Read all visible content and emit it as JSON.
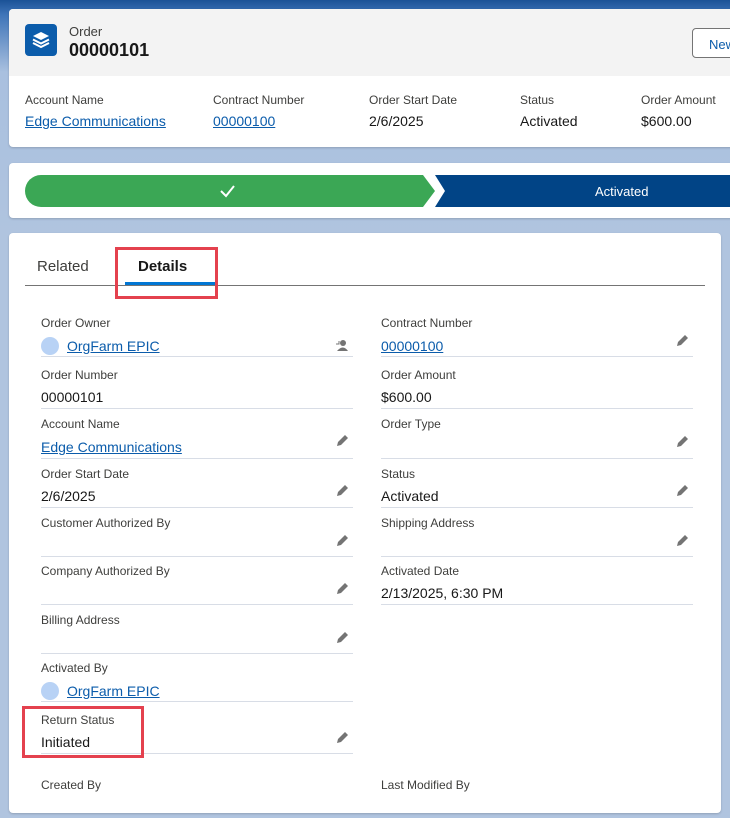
{
  "header": {
    "object_type": "Order",
    "title": "00000101",
    "new_button": "New",
    "fields": [
      {
        "label": "Account Name",
        "value": "Edge Communications"
      },
      {
        "label": "Contract Number",
        "value": "00000100"
      },
      {
        "label": "Order Start Date",
        "value": "2/6/2025"
      },
      {
        "label": "Status",
        "value": "Activated"
      },
      {
        "label": "Order Amount",
        "value": "$600.00"
      }
    ]
  },
  "path": {
    "current_stage": "Activated",
    "completed_color": "#3ba755",
    "active_color": "#014486"
  },
  "tabs": [
    "Related",
    "Details"
  ],
  "details": {
    "order_owner": {
      "label": "Order Owner",
      "value": "OrgFarm EPIC"
    },
    "contract_number": {
      "label": "Contract Number",
      "value": "00000100"
    },
    "order_number": {
      "label": "Order Number",
      "value": "00000101"
    },
    "order_amount": {
      "label": "Order Amount",
      "value": "$600.00"
    },
    "account_name": {
      "label": "Account Name",
      "value": "Edge Communications"
    },
    "order_type": {
      "label": "Order Type",
      "value": ""
    },
    "order_start_date": {
      "label": "Order Start Date",
      "value": "2/6/2025"
    },
    "status": {
      "label": "Status",
      "value": "Activated"
    },
    "customer_authorized_by": {
      "label": "Customer Authorized By",
      "value": ""
    },
    "shipping_address": {
      "label": "Shipping Address",
      "value": ""
    },
    "company_authorized_by": {
      "label": "Company Authorized By",
      "value": ""
    },
    "activated_date": {
      "label": "Activated Date",
      "value": "2/13/2025, 6:30 PM"
    },
    "billing_address": {
      "label": "Billing Address",
      "value": ""
    },
    "activated_by": {
      "label": "Activated By",
      "value": "OrgFarm EPIC"
    },
    "return_status": {
      "label": "Return Status",
      "value": "Initiated"
    },
    "created_by": {
      "label": "Created By",
      "value": ""
    },
    "last_modified_by": {
      "label": "Last Modified By",
      "value": ""
    }
  }
}
